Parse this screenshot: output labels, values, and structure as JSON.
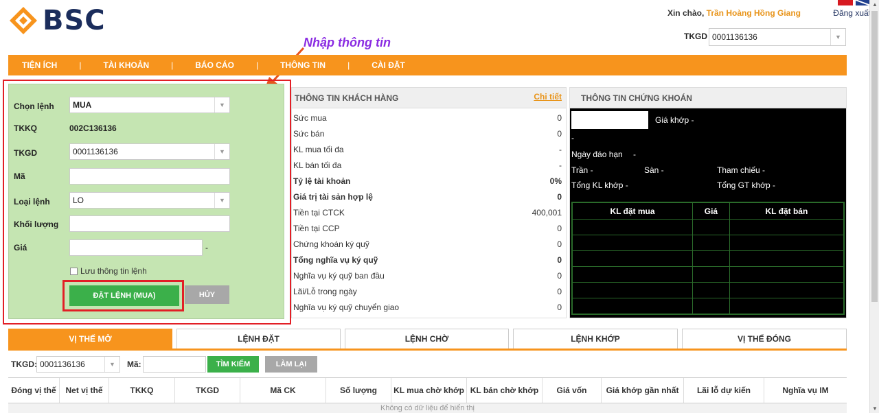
{
  "brand": {
    "name": "BSC"
  },
  "header": {
    "greeting": "Xin chào,",
    "user_name": "Trần Hoàng Hồng Giang",
    "logout": "Đăng xuất",
    "tkgd_label": "TKGD",
    "tkgd_value": "0001136136"
  },
  "annotation": "Nhập thông tin",
  "menu": [
    "TIỆN ÍCH",
    "TÀI KHOẢN",
    "BÁO CÁO",
    "THÔNG TIN",
    "CÀI ĐẶT"
  ],
  "order_form": {
    "chon_lenh_label": "Chọn lệnh",
    "chon_lenh_value": "MUA",
    "tkkq_label": "TKKQ",
    "tkkq_value": "002C136136",
    "tkgd_label": "TKGD",
    "tkgd_value": "0001136136",
    "ma_label": "Mã",
    "ma_value": "",
    "loai_lenh_label": "Loại lệnh",
    "loai_lenh_value": "LO",
    "khoi_luong_label": "Khối lượng",
    "khoi_luong_value": "",
    "gia_label": "Giá",
    "gia_value": "",
    "gia_suffix": "-",
    "save_label": "Lưu thông tin lệnh",
    "submit_label": "ĐẶT LỆNH (MUA)",
    "cancel_label": "HỦY"
  },
  "customer_info": {
    "title": "THÔNG TIN KHÁCH HÀNG",
    "detail_link": "Chi tiết",
    "rows": [
      {
        "label": "Sức mua",
        "value": "0"
      },
      {
        "label": "Sức bán",
        "value": "0"
      },
      {
        "label": "KL mua tối đa",
        "value": "-"
      },
      {
        "label": "KL bán tối đa",
        "value": "-"
      },
      {
        "label": "Tỷ lệ tài khoản",
        "value": "0%"
      },
      {
        "label": "Giá trị tài sản hợp lệ",
        "value": "0"
      },
      {
        "label": "Tiền tại CTCK",
        "value": "400,001"
      },
      {
        "label": "Tiền tại CCP",
        "value": "0"
      },
      {
        "label": "Chứng khoán ký quỹ",
        "value": "0"
      },
      {
        "label": "Tổng nghĩa vụ ký quỹ",
        "value": "0"
      },
      {
        "label": "Nghĩa vụ ký quỹ ban đầu",
        "value": "0"
      },
      {
        "label": "Lãi/Lỗ trong ngày",
        "value": "0"
      },
      {
        "label": "Nghĩa vụ ký quỹ chuyển giao",
        "value": "0"
      }
    ]
  },
  "securities_info": {
    "title": "THÔNG TIN CHỨNG KHOÁN",
    "gia_khop": "Giá khớp -",
    "dash": "-",
    "ngay_dao_han": "Ngày đáo hạn",
    "ngay_dao_han_value": "-",
    "tran": "Trần -",
    "san": "Sàn -",
    "tham_chieu": "Tham chiếu -",
    "tong_kl_khop": "Tổng KL khớp -",
    "tong_gt_khop": "Tổng GT khớp -",
    "grid_headers": [
      "KL đặt mua",
      "Giá",
      "KL đặt bán"
    ]
  },
  "tabs": [
    "VỊ THẾ MỞ",
    "LỆNH ĐẶT",
    "LỆNH CHỜ",
    "LỆNH KHỚP",
    "VỊ THẾ ĐÓNG"
  ],
  "filter": {
    "tkgd_label": "TKGD:",
    "tkgd_value": "0001136136",
    "ma_label": "Mã:",
    "ma_value": "",
    "search_label": "TÌM KIẾM",
    "reset_label": "LÀM LẠI"
  },
  "positions_table": {
    "columns": [
      "Đóng vị thế",
      "Net vị thế",
      "TKKQ",
      "TKGD",
      "Mã CK",
      "Số lượng",
      "KL mua chờ khớp",
      "KL bán chờ khớp",
      "Giá vốn",
      "Giá khớp gần nhất",
      "Lãi lỗ dự kiến",
      "Nghĩa vụ IM"
    ],
    "empty_text": "Không có dữ liệu để hiển thị"
  },
  "colors": {
    "accent": "#f7941d",
    "form_bg": "#c5e5b2",
    "primary_button": "#3bb04a",
    "highlight_box": "#e21f26"
  }
}
